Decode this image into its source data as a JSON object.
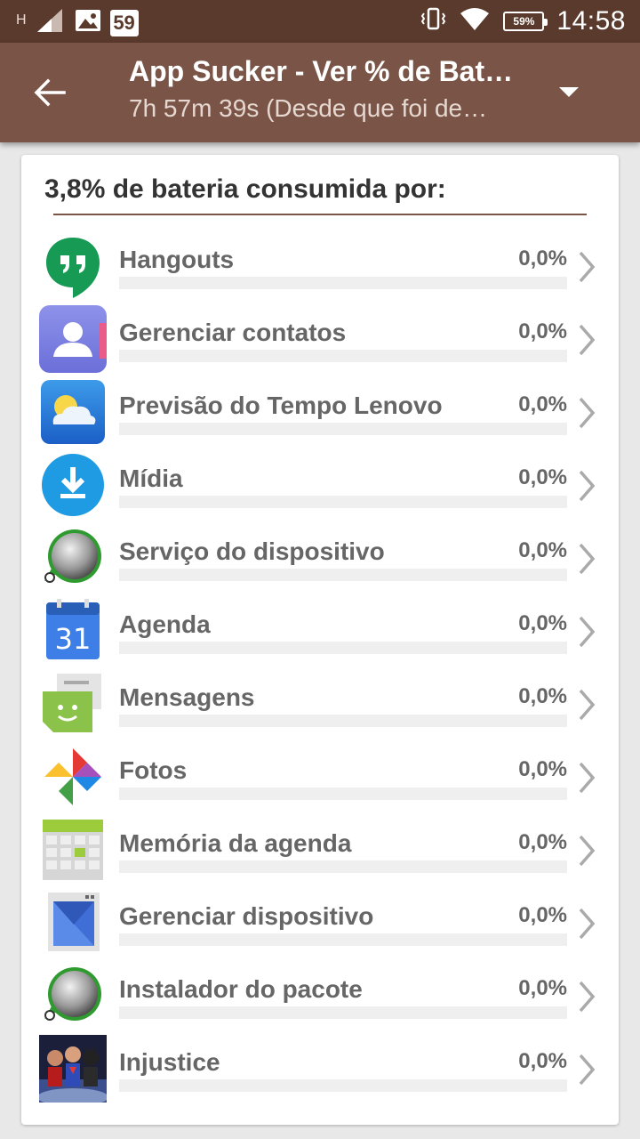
{
  "status_bar": {
    "network_label": "H",
    "notification_count": "59",
    "battery": "59%",
    "time": "14:58",
    "icons": [
      "signal-icon",
      "image-icon",
      "notification-badge-icon",
      "vibrate-icon",
      "wifi-icon",
      "battery-icon"
    ]
  },
  "toolbar": {
    "title": "App Sucker - Ver % de Bat…",
    "subtitle": "7h 57m 39s (Desde que foi de…",
    "icons": [
      "back-arrow-icon",
      "dropdown-arrow-icon"
    ]
  },
  "card": {
    "header": "3,8% de bateria consumida por:"
  },
  "colors": {
    "status_bar": "#5a3a2c",
    "toolbar": "#7a5547",
    "divider": "#7a5547",
    "background": "#e8e8e8"
  },
  "apps": [
    {
      "name": "Hangouts",
      "percent": "0,0%",
      "usage": 0,
      "icon": "hangouts-icon"
    },
    {
      "name": "Gerenciar contatos",
      "percent": "0,0%",
      "usage": 0,
      "icon": "contacts-icon"
    },
    {
      "name": "Previsão do Tempo Lenovo",
      "percent": "0,0%",
      "usage": 0,
      "icon": "weather-icon"
    },
    {
      "name": "Mídia",
      "percent": "0,0%",
      "usage": 0,
      "icon": "download-icon"
    },
    {
      "name": "Serviço do dispositivo",
      "percent": "0,0%",
      "usage": 0,
      "icon": "android-system-icon"
    },
    {
      "name": "Agenda",
      "percent": "0,0%",
      "usage": 0,
      "icon": "calendar-icon"
    },
    {
      "name": "Mensagens",
      "percent": "0,0%",
      "usage": 0,
      "icon": "messages-icon"
    },
    {
      "name": "Fotos",
      "percent": "0,0%",
      "usage": 0,
      "icon": "photos-icon"
    },
    {
      "name": "Memória da agenda",
      "percent": "0,0%",
      "usage": 0,
      "icon": "calendar-storage-icon"
    },
    {
      "name": "Gerenciar dispositivo",
      "percent": "0,0%",
      "usage": 0,
      "icon": "device-manager-icon"
    },
    {
      "name": "Instalador do pacote",
      "percent": "0,0%",
      "usage": 0,
      "icon": "package-installer-icon"
    },
    {
      "name": "Injustice",
      "percent": "0,0%",
      "usage": 0,
      "icon": "injustice-game-icon"
    }
  ]
}
